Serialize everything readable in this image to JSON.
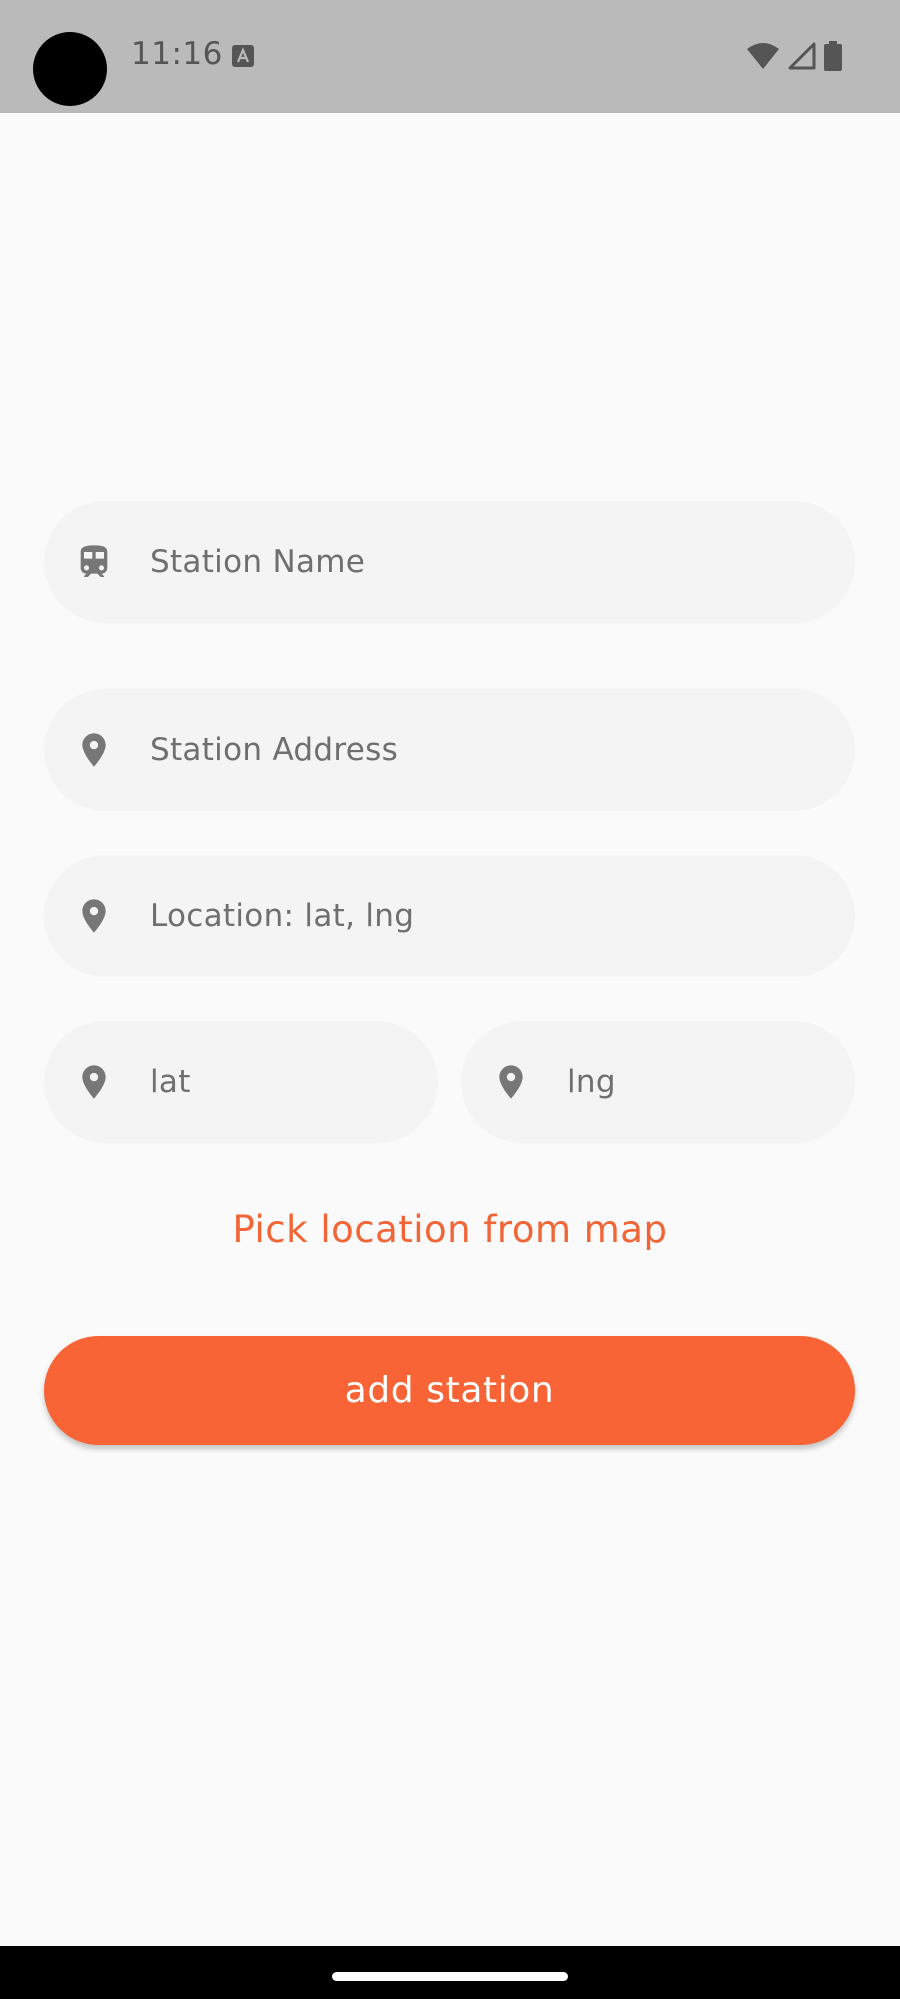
{
  "status_bar": {
    "time": "11:16",
    "icons": [
      "camera-cutout",
      "text-notification-icon",
      "wifi-icon",
      "signal-icon",
      "battery-icon"
    ]
  },
  "form": {
    "station_name": {
      "placeholder": "Station Name",
      "icon": "train-icon"
    },
    "station_address": {
      "placeholder": "Station Address",
      "icon": "location-pin-icon"
    },
    "location": {
      "placeholder": "Location: lat, lng",
      "icon": "location-pin-icon"
    },
    "lat": {
      "placeholder": "lat",
      "icon": "location-pin-icon"
    },
    "lng": {
      "placeholder": "lng",
      "icon": "location-pin-icon"
    }
  },
  "pick_location_link": "Pick location from map",
  "add_button_label": "add station",
  "colors": {
    "accent": "#f86435",
    "link": "#f26537",
    "field_bg": "#f4f4f4",
    "icon": "#777777",
    "background": "#fafafa"
  }
}
